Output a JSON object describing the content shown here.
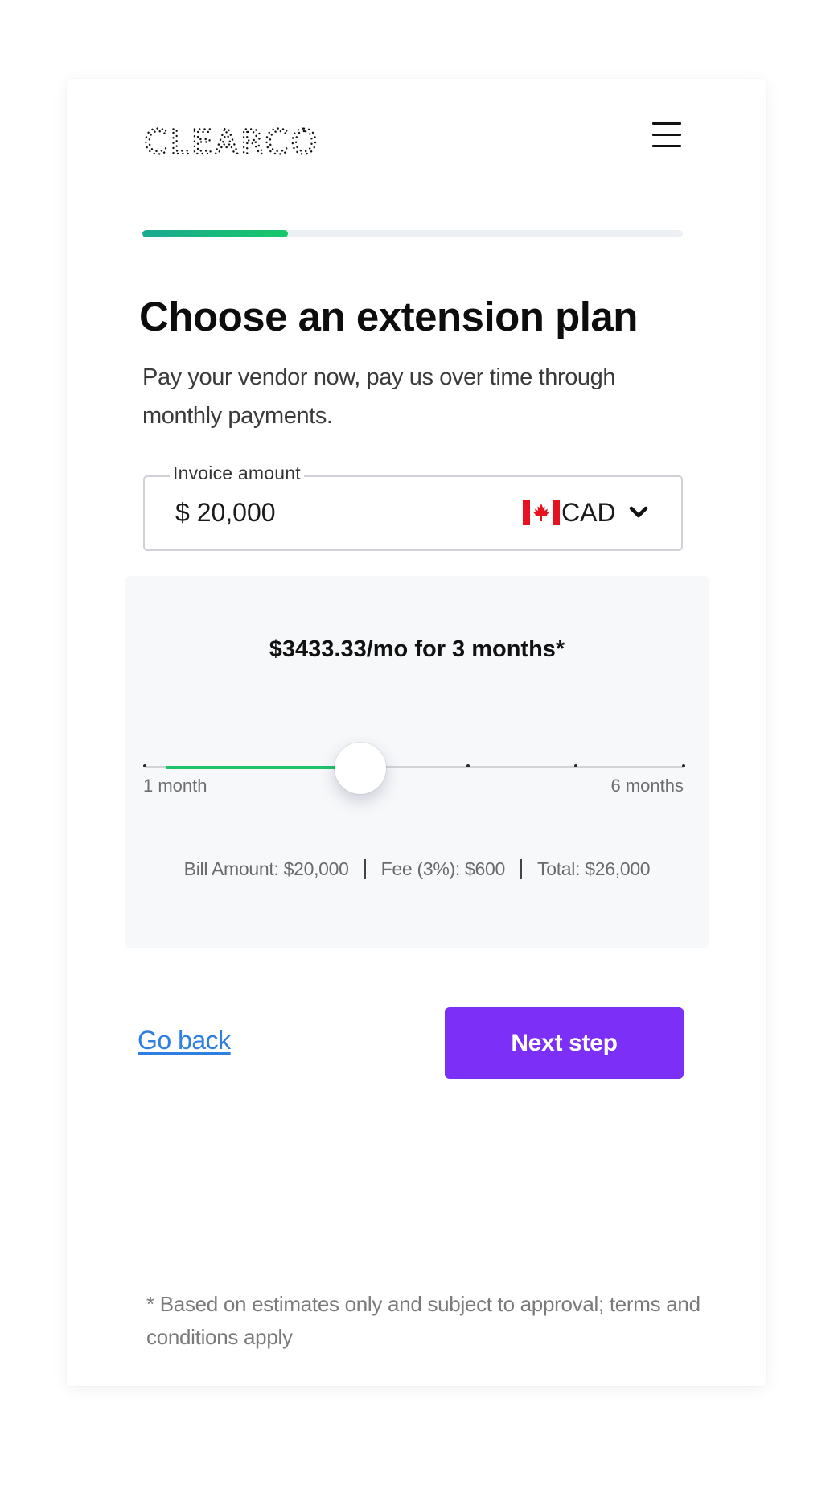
{
  "brand": {
    "logo_text": "CLEARCO"
  },
  "progress": {
    "fraction": 0.27,
    "accent_from": "#1ba891",
    "accent_to": "#17c86a"
  },
  "header": {
    "menu_icon": "hamburger-menu-icon"
  },
  "page": {
    "title": "Choose an extension plan",
    "subtitle": "Pay your vendor now, pay us over time through monthly payments."
  },
  "invoice": {
    "legend": "Invoice amount",
    "value": "$ 20,000",
    "currency": "CAD",
    "currency_flag_icon": "canada-flag-icon",
    "dropdown_icon": "chevron-down-icon"
  },
  "plan": {
    "summary": "$3433.33/mo for 3 months*",
    "slider": {
      "min": 1,
      "max": 6,
      "value": 3,
      "min_label": "1 month",
      "max_label": "6 months",
      "fill_color": "#1ec46a"
    },
    "breakdown": {
      "bill": "Bill Amount: $20,000",
      "fee": "Fee (3%): $600",
      "total": "Total: $26,000"
    }
  },
  "actions": {
    "back_label": "Go back",
    "next_label": "Next step",
    "next_color": "#7b2ff7",
    "link_color": "#2f7fe0"
  },
  "footer": {
    "disclaimer": "* Based on estimates only and subject to approval; terms and conditions apply"
  }
}
